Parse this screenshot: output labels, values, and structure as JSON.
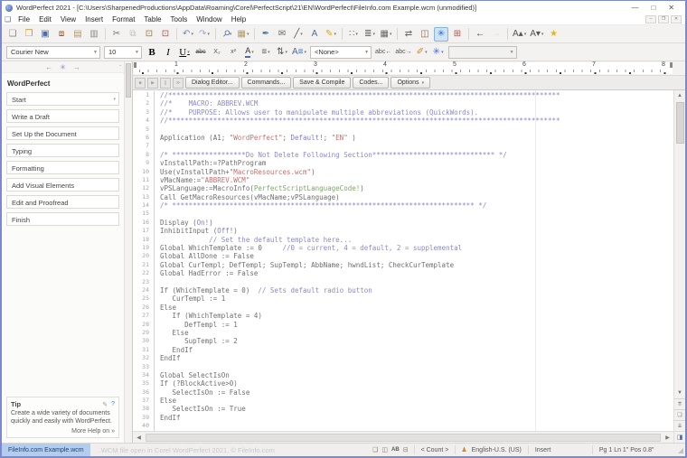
{
  "window": {
    "title": "WordPerfect 2021 - [C:\\Users\\SharpenedProductions\\AppData\\Roaming\\Corel\\PerfectScript\\21\\EN\\WordPerfect\\FileInfo.com Example.wcm (unmodified)]",
    "controls": {
      "minimize": "—",
      "maximize": "□",
      "close": "✕"
    },
    "doc_controls": {
      "minimize": "–",
      "restore": "❐",
      "close": "✕"
    }
  },
  "menu": {
    "items": [
      "File",
      "Edit",
      "View",
      "Insert",
      "Format",
      "Table",
      "Tools",
      "Window",
      "Help"
    ],
    "doc_icon": "❏"
  },
  "toolbar": {
    "buttons": [
      {
        "n": "new-document",
        "g": "❏",
        "c": "#8a8a8a"
      },
      {
        "n": "open",
        "g": "❒",
        "c": "#c9962a"
      },
      {
        "n": "save",
        "g": "▣",
        "c": "#4a6da8"
      },
      {
        "n": "save-all",
        "g": "⧈",
        "c": "#a0522d"
      },
      {
        "n": "print-preview",
        "g": "▤",
        "c": "#b09a6a"
      },
      {
        "n": "print",
        "g": "▥",
        "c": "#8a8a8a"
      },
      {
        "sep": true
      },
      {
        "n": "cut",
        "g": "✂",
        "c": "#777777"
      },
      {
        "n": "copy",
        "g": "⧉",
        "c": "#777777",
        "disabled": true
      },
      {
        "n": "paste",
        "g": "⊡",
        "c": "#a8742f"
      },
      {
        "n": "paste-special",
        "g": "⊡",
        "c": "#b5524a"
      },
      {
        "sep": true
      },
      {
        "n": "undo",
        "g": "↶",
        "c": "#6a86b8",
        "d": true
      },
      {
        "n": "redo",
        "g": "↷",
        "c": "#9aaabb",
        "d": true
      },
      {
        "sep": true
      },
      {
        "n": "zoom",
        "g": "⚲",
        "c": "#5a7ab5",
        "cls": "rot45",
        "d": true
      },
      {
        "n": "insert-date",
        "g": "▦",
        "c": "#b09a6a",
        "d": true
      },
      {
        "sep": true
      },
      {
        "n": "quickformat",
        "g": "✒",
        "c": "#3a7ab0"
      },
      {
        "n": "mail",
        "g": "✉",
        "c": "#666666"
      },
      {
        "n": "draw-line",
        "g": "╱",
        "c": "#555555",
        "d": true
      },
      {
        "n": "text-box",
        "g": "A",
        "c": "#4a6da8"
      },
      {
        "n": "highlight",
        "g": "✎",
        "c": "#d4aa20",
        "d": true
      },
      {
        "sep": true
      },
      {
        "n": "bullet-list",
        "g": "∷",
        "c": "#666666",
        "d": true
      },
      {
        "n": "numbered-list",
        "g": "≣",
        "c": "#666666",
        "d": true
      },
      {
        "n": "table",
        "g": "▦",
        "c": "#666666",
        "d": true
      },
      {
        "sep": true
      },
      {
        "n": "merge",
        "g": "⇄",
        "c": "#666666"
      },
      {
        "n": "reference-book",
        "g": "◫",
        "c": "#8a6a4a"
      },
      {
        "n": "macro-play",
        "g": "✳",
        "c": "#2a6ad4",
        "active": true
      },
      {
        "n": "macro-record",
        "g": "⊞",
        "c": "#b5524a"
      },
      {
        "sep": true
      },
      {
        "n": "back",
        "g": "←",
        "c": "#333333"
      },
      {
        "n": "forward",
        "g": "→",
        "c": "#bbbbbb",
        "disabled": true
      },
      {
        "sep": true
      },
      {
        "n": "font-size-up",
        "g": "A▴",
        "c": "#555555",
        "d": true
      },
      {
        "n": "font-size-down",
        "g": "A▾",
        "c": "#555555",
        "d": true
      },
      {
        "n": "favorites",
        "g": "★",
        "c": "#e0b820"
      }
    ]
  },
  "propertybar": {
    "font": "Courier New",
    "size": "10",
    "style": "<None>",
    "buttons": [
      {
        "n": "bold",
        "g": "B",
        "cls": "pbold"
      },
      {
        "n": "italic",
        "g": "I",
        "cls": "pital"
      },
      {
        "n": "underline",
        "g": "U",
        "cls": "punder",
        "d": true
      },
      {
        "n": "strikethrough",
        "g": "abc",
        "cls": "pstrike"
      },
      {
        "n": "subscript",
        "g": "X₂",
        "cls": "psmall"
      },
      {
        "n": "superscript",
        "g": "x²",
        "cls": "psmall"
      },
      {
        "n": "font-color",
        "g": "A",
        "cls": "pfcolor",
        "d": true
      },
      {
        "n": "justification",
        "g": "≡",
        "c": "#555555",
        "d": true
      },
      {
        "n": "line-spacing",
        "g": "⇅",
        "c": "#555555",
        "d": true
      },
      {
        "n": "font-attributes",
        "g": "A≡",
        "c": "#4a6da8",
        "d": true
      }
    ],
    "buttons2": [
      {
        "n": "quickword-prev",
        "g": "abc←",
        "cls": "psmall"
      },
      {
        "n": "quickword-next",
        "g": "abc→",
        "cls": "psmall"
      },
      {
        "n": "edit-graphic",
        "g": "✐",
        "c": "#c8862a",
        "d": true
      },
      {
        "n": "macro-tools",
        "g": "✳",
        "c": "#4a6ad4",
        "d": true
      }
    ]
  },
  "ruler": {
    "numbers": [
      "1",
      "2",
      "3",
      "4",
      "5",
      "6",
      "7",
      "8"
    ]
  },
  "macrobar": {
    "vcr": [
      "■",
      "▶",
      "∥",
      "≫"
    ],
    "buttons": [
      "Dialog Editor...",
      "Commands...",
      "Save & Compile",
      "Codes...",
      "Options"
    ]
  },
  "sidebar": {
    "nav": [
      "←",
      "✳",
      "→"
    ],
    "title": "WordPerfect",
    "items": [
      {
        "label": "Start",
        "dropdown": true
      },
      {
        "label": "Write a Draft"
      },
      {
        "label": "Set Up the Document"
      },
      {
        "label": "Typing"
      },
      {
        "label": "Formatting"
      },
      {
        "label": "Add Visual Elements"
      },
      {
        "label": "Edit and Proofread"
      },
      {
        "label": "Finish"
      }
    ],
    "tip": {
      "title": "Tip",
      "pin": "✎",
      "help": "?",
      "body": "Create a wide variety of documents quickly and easily with WordPerfect.",
      "more": "More Help on »"
    }
  },
  "editor": {
    "lines": [
      {
        "n": "1",
        "seg": [
          [
            "c",
            "//************************************************************************************************"
          ]
        ]
      },
      {
        "n": "2",
        "seg": [
          [
            "c",
            "//*    MACRO: ABBREV.WCM"
          ]
        ]
      },
      {
        "n": "3",
        "seg": [
          [
            "c",
            "//*    PURPOSE: Allows user to manipulate multiple abbreviations (QuickWords)."
          ]
        ]
      },
      {
        "n": "4",
        "seg": [
          [
            "c",
            "//************************************************************************************************"
          ]
        ]
      },
      {
        "n": "5",
        "seg": []
      },
      {
        "n": "6",
        "seg": [
          [
            "d",
            "Application (A1; "
          ],
          [
            "s",
            "\"WordPerfect\""
          ],
          [
            "d",
            "; "
          ],
          [
            "k",
            "Default!"
          ],
          [
            "d",
            "; "
          ],
          [
            "s",
            "\"EN\""
          ],
          [
            "d",
            " )"
          ]
        ]
      },
      {
        "n": "7",
        "seg": []
      },
      {
        "n": "8",
        "seg": [
          [
            "c",
            "/* ******************Do Not Delete Following Section****************************** */"
          ]
        ]
      },
      {
        "n": "9",
        "seg": [
          [
            "d",
            "vInstallPath:=?PathProgram"
          ]
        ]
      },
      {
        "n": "10",
        "seg": [
          [
            "d",
            "Use(vInstallPath+"
          ],
          [
            "s",
            "\"MacroResources.wcm\""
          ],
          [
            "d",
            ")"
          ]
        ]
      },
      {
        "n": "11",
        "seg": [
          [
            "d",
            "vMacName:="
          ],
          [
            "s",
            "\"ABBREV.WCM\""
          ]
        ]
      },
      {
        "n": "12",
        "seg": [
          [
            "d",
            "vPSLanguage:=MacroInfo("
          ],
          [
            "g",
            "PerfectScriptLanguageCode!"
          ],
          [
            "d",
            ")"
          ]
        ]
      },
      {
        "n": "13",
        "seg": [
          [
            "d",
            "Call GetMacroResources(vMacName;vPSLanguage)"
          ]
        ]
      },
      {
        "n": "14",
        "seg": [
          [
            "c",
            "/* ************************************************************************** */"
          ]
        ]
      },
      {
        "n": "15",
        "seg": []
      },
      {
        "n": "16",
        "seg": [
          [
            "d",
            "Display ("
          ],
          [
            "k",
            "On!"
          ],
          [
            "d",
            ")"
          ]
        ]
      },
      {
        "n": "17",
        "seg": [
          [
            "d",
            "InhibitInput ("
          ],
          [
            "k",
            "Off!"
          ],
          [
            "d",
            ")"
          ]
        ]
      },
      {
        "n": "18",
        "seg": [
          [
            "c",
            "            // Set the default template here..."
          ]
        ]
      },
      {
        "n": "19",
        "seg": [
          [
            "d",
            "Global WhichTemplate := 0     "
          ],
          [
            "c",
            "//0 = current, 4 = default, 2 = supplemental"
          ]
        ]
      },
      {
        "n": "20",
        "seg": [
          [
            "d",
            "Global AllDone := False"
          ]
        ]
      },
      {
        "n": "21",
        "seg": [
          [
            "d",
            "Global CurTempl; DefTempl; SupTempl; AbbName; hwndList; CheckCurTemplate"
          ]
        ]
      },
      {
        "n": "22",
        "seg": [
          [
            "d",
            "Global HadError := False"
          ]
        ]
      },
      {
        "n": "23",
        "seg": []
      },
      {
        "n": "24",
        "seg": [
          [
            "d",
            "If (WhichTemplate = 0)  "
          ],
          [
            "c",
            "// Sets default radio button"
          ]
        ]
      },
      {
        "n": "25",
        "seg": [
          [
            "d",
            "   CurTempl := 1"
          ]
        ]
      },
      {
        "n": "26",
        "seg": [
          [
            "d",
            "Else"
          ]
        ]
      },
      {
        "n": "27",
        "seg": [
          [
            "d",
            "   If (WhichTemplate = 4)"
          ]
        ]
      },
      {
        "n": "28",
        "seg": [
          [
            "d",
            "      DefTempl := 1"
          ]
        ]
      },
      {
        "n": "29",
        "seg": [
          [
            "d",
            "   Else"
          ]
        ]
      },
      {
        "n": "30",
        "seg": [
          [
            "d",
            "      SupTempl := 2"
          ]
        ]
      },
      {
        "n": "31",
        "seg": [
          [
            "d",
            "   EndIf"
          ]
        ]
      },
      {
        "n": "32",
        "seg": [
          [
            "d",
            "EndIf"
          ]
        ]
      },
      {
        "n": "33",
        "seg": []
      },
      {
        "n": "34",
        "seg": [
          [
            "d",
            "Global SelectIsOn"
          ]
        ]
      },
      {
        "n": "35",
        "seg": [
          [
            "d",
            "If (?BlockActive>0)"
          ]
        ]
      },
      {
        "n": "36",
        "seg": [
          [
            "d",
            "   SelectIsOn := False"
          ]
        ]
      },
      {
        "n": "37",
        "seg": [
          [
            "d",
            "Else"
          ]
        ]
      },
      {
        "n": "38",
        "seg": [
          [
            "d",
            "   SelectIsOn := True"
          ]
        ]
      },
      {
        "n": "39",
        "seg": [
          [
            "d",
            "EndIf"
          ]
        ]
      },
      {
        "n": "40",
        "seg": []
      }
    ]
  },
  "scrollbar": {
    "up": "▲",
    "down": "▼",
    "left": "◀",
    "right": "▶",
    "prev_page": "⇈",
    "page": "❏",
    "next_page": "⇊",
    "browse": "◨"
  },
  "statusbar": {
    "tab": "FileInfo.com Example.wcm",
    "watermark": ".WCM file open in Corel WordPerfect 2021. © FileInfo.com",
    "icons": {
      "page": "❏",
      "book": "◫",
      "ab": "AB",
      "printer": "⊟"
    },
    "count": "< Count >",
    "person": "♟",
    "language": "English-U.S. (US)",
    "mode": "Insert",
    "position": "Pg 1 Ln 1\" Pos 0.8\"",
    "grip": "◢"
  }
}
